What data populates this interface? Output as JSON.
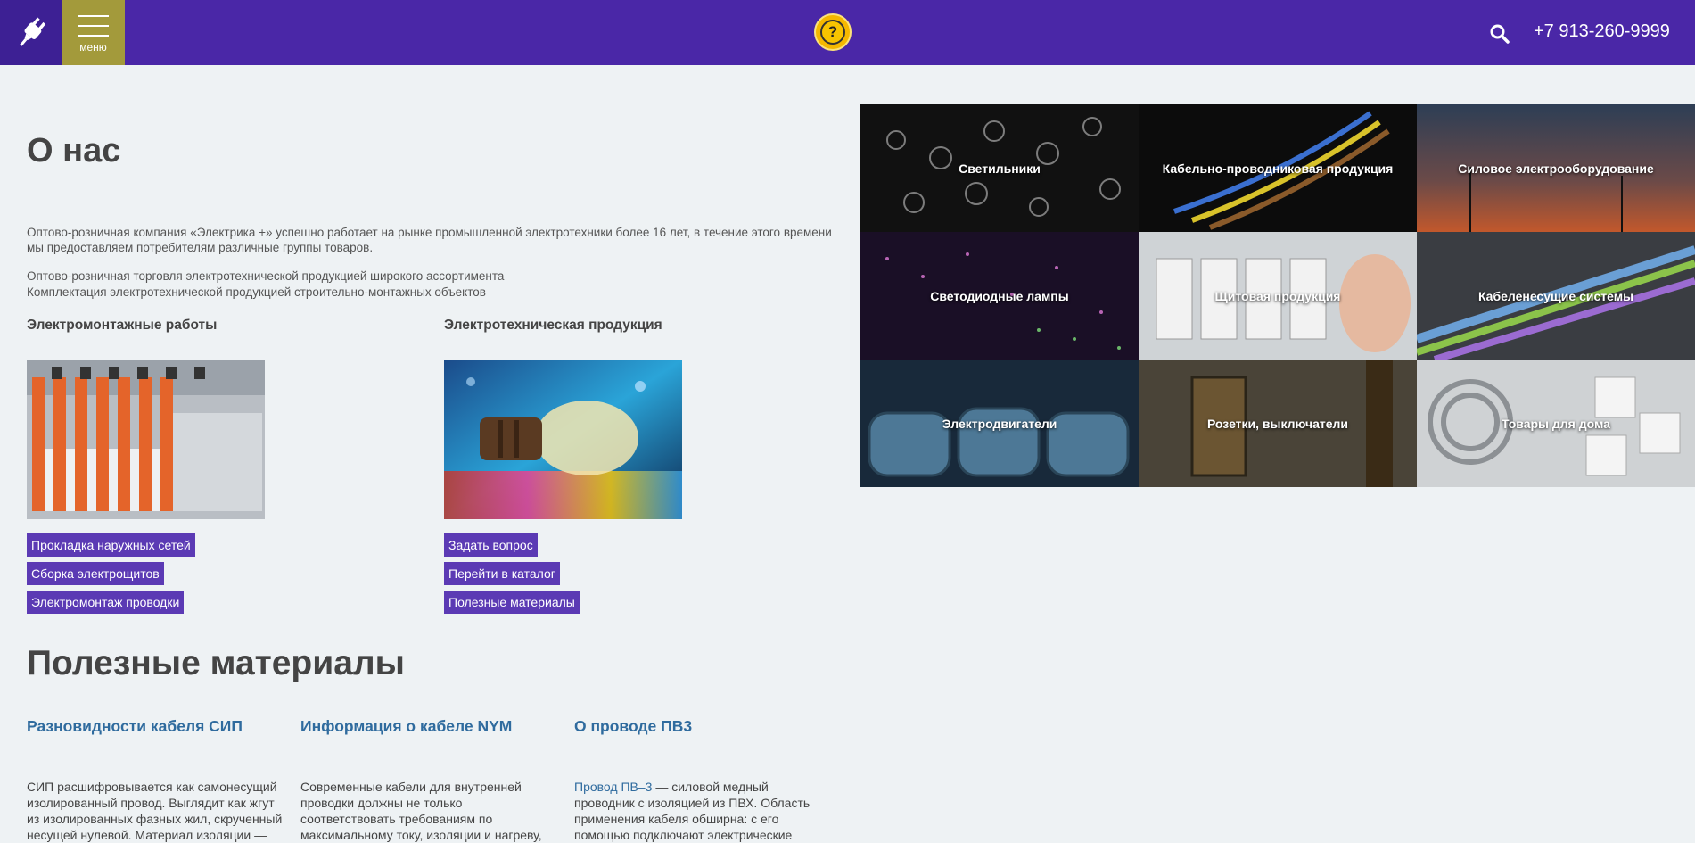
{
  "header": {
    "menu_label": "меню",
    "help_symbol": "?",
    "phone": "+7 913-260-9999",
    "colors": {
      "bar": "#4a27a7",
      "menu": "#a39a3b",
      "help": "#f5b800"
    }
  },
  "about": {
    "title": "О нас",
    "intro": "Оптово-розничная компания «Электрика +» успешно работает на рынке промышленной электротехники более 16 лет, в течение этого времени мы предоставляем потребителям различные группы товаров.",
    "line1": "Оптово-розничная торговля электротехнической продукцией широкого ассортимента",
    "line2": "Комплектация электротехнической продукцией строительно-монтажных объектов",
    "columns": [
      {
        "title": "Электромонтажные работы",
        "links": [
          "Прокладка наружных сетей",
          "Сборка электрощитов",
          "Электромонтаж проводки"
        ]
      },
      {
        "title": "Электротехническая продукция",
        "links": [
          "Задать вопрос",
          "Перейти в каталог",
          "Полезные материалы"
        ]
      }
    ]
  },
  "categories": [
    "Светильники",
    "Кабельно-проводниковая продукция",
    "Силовое электрооборудование",
    "Светодиодные лампы",
    "Щитовая продукция",
    "Кабеленесущие системы",
    "Электродвигатели",
    "Розетки, выключатели",
    "Товары для дома"
  ],
  "materials": {
    "title": "Полезные материалы",
    "articles": [
      {
        "title": "Разновидности кабеля СИП",
        "lines": [
          "СИП расшифровывается как самонесущий",
          "изолированный провод. Выглядит как жгут",
          "из изолированных фазных жил, скрученный",
          "несущей нулевой. Материал изоляции —"
        ]
      },
      {
        "title": "Информация о кабеле NYM",
        "lines": [
          "Современные кабели для внутренней",
          "проводки должны не только",
          "соответствовать требованиям по",
          "максимальному току, изоляции и нагреву,"
        ]
      },
      {
        "title": "О проводе ПВ3",
        "link": "Провод ПВ–3",
        "line1_rest": " — силовой медный",
        "lines": [
          "проводник с изоляцией из ПВХ. Область",
          "применения кабеля обширна: с его",
          "помощью подключают электрические"
        ]
      }
    ]
  }
}
